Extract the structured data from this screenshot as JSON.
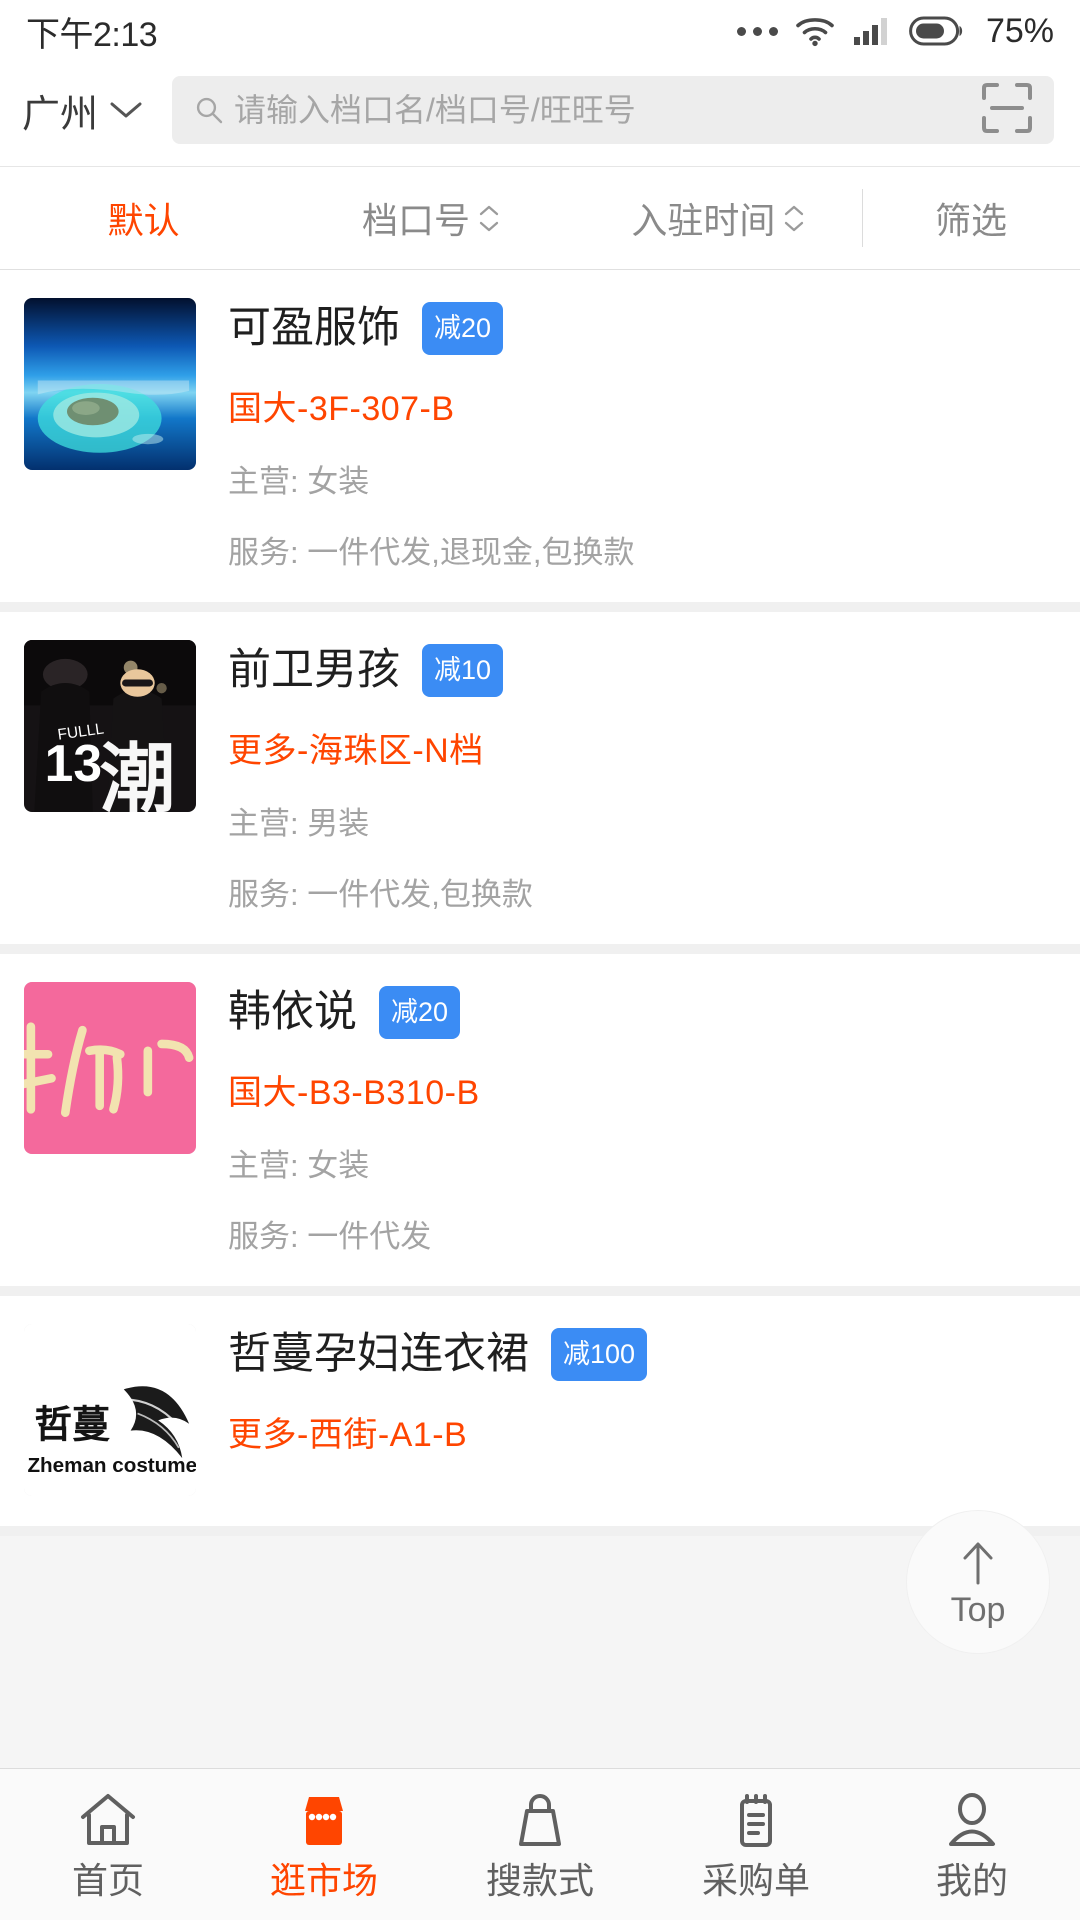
{
  "status_bar": {
    "time": "下午2:13",
    "battery_percent": "75%",
    "icons": [
      "more-dots-icon",
      "wifi-icon",
      "signal-icon",
      "battery-icon"
    ]
  },
  "header": {
    "city": "广州",
    "city_chevron": "chevron-down-icon",
    "search_placeholder": "请输入档口名/档口号/旺旺号",
    "search_value": "",
    "search_icon": "search-icon",
    "scan_icon": "scan-qr-icon"
  },
  "sortbar": {
    "items": [
      {
        "label": "默认",
        "active": true,
        "has_sort_arrows": false
      },
      {
        "label": "档口号",
        "active": false,
        "has_sort_arrows": true
      },
      {
        "label": "入驻时间",
        "active": false,
        "has_sort_arrows": true
      },
      {
        "label": "筛选",
        "active": false,
        "has_sort_arrows": false
      }
    ]
  },
  "colors": {
    "accent_orange": "#ff4500",
    "badge_blue": "#3b8cf4",
    "muted_grey": "#a3a3a3"
  },
  "shops": [
    {
      "name": "可盈服饰",
      "badge": "减20",
      "address": "国大-3F-307-B",
      "category": "主营: 女装",
      "service": "服务: 一件代发,退现金,包换款",
      "thumb": "island-ocean-photo"
    },
    {
      "name": "前卫男孩",
      "badge": "减10",
      "address": "更多-海珠区-N档",
      "category": "主营: 男装",
      "service": "服务: 一件代发,包换款",
      "thumb": "streetwear-photo"
    },
    {
      "name": "韩依说",
      "badge": "减20",
      "address": "国大-B3-B310-B",
      "category": "主营: 女装",
      "service": "服务: 一件代发",
      "thumb": "pink-calligraphy-logo"
    },
    {
      "name": "哲蔓孕妇连衣裙",
      "badge": "减100",
      "address": "更多-西街-A1-B",
      "category": "",
      "service": "",
      "thumb": "zheman-costume-logo"
    }
  ],
  "back_to_top": {
    "label": "Top",
    "icon": "arrow-up-icon"
  },
  "tabbar": {
    "items": [
      {
        "label": "首页",
        "icon": "home-icon",
        "active": false
      },
      {
        "label": "逛市场",
        "icon": "shop-icon",
        "active": true
      },
      {
        "label": "搜款式",
        "icon": "bag-icon",
        "active": false
      },
      {
        "label": "采购单",
        "icon": "clipboard-icon",
        "active": false
      },
      {
        "label": "我的",
        "icon": "person-icon",
        "active": false
      }
    ]
  }
}
